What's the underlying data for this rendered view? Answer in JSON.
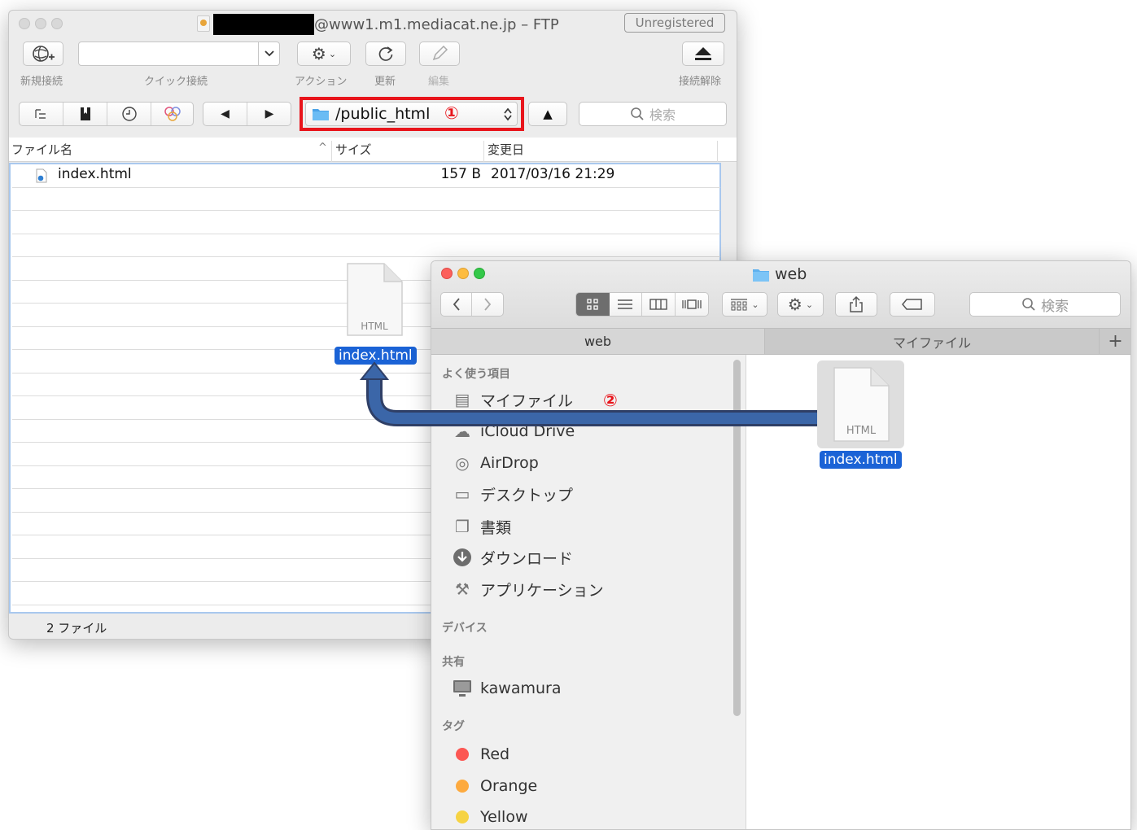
{
  "ftp": {
    "title_suffix": "@www1.m1.mediacat.ne.jp – FTP",
    "unregistered": "Unregistered",
    "toolbar": {
      "new_connection": "新規接続",
      "quick_connect": "クイック接続",
      "action": "アクション",
      "refresh": "更新",
      "edit": "編集",
      "disconnect": "接続解除"
    },
    "path": "/public_html",
    "marker1": "①",
    "search_placeholder": "検索",
    "columns": {
      "name": "ファイル名",
      "size": "サイズ",
      "modified": "変更日"
    },
    "files": [
      {
        "name": "index.html",
        "size": "157 B",
        "modified": "2017/03/16 21:29"
      }
    ],
    "status": "2 ファイル",
    "dragged_label": "index.html",
    "doc_type": "HTML"
  },
  "finder": {
    "title": "web",
    "search_placeholder": "検索",
    "tabs": [
      "web",
      "マイファイル"
    ],
    "add_tab": "+",
    "sidebar": {
      "favorites_header": "よく使う項目",
      "favorites": [
        "マイファイル",
        "iCloud Drive",
        "AirDrop",
        "デスクトップ",
        "書類",
        "ダウンロード",
        "アプリケーション"
      ],
      "devices_header": "デバイス",
      "shared_header": "共有",
      "shared": [
        "kawamura"
      ],
      "tags_header": "タグ",
      "tags": [
        {
          "name": "Red",
          "color": "#fc5753"
        },
        {
          "name": "Orange",
          "color": "#fdaa3f"
        },
        {
          "name": "Yellow",
          "color": "#f6d343"
        }
      ]
    },
    "marker2": "②",
    "file_label": "index.html",
    "doc_type": "HTML"
  },
  "colors": {
    "accent": "#1b63d6",
    "highlight": "#e8141b",
    "arrow": "#3b66a8"
  }
}
